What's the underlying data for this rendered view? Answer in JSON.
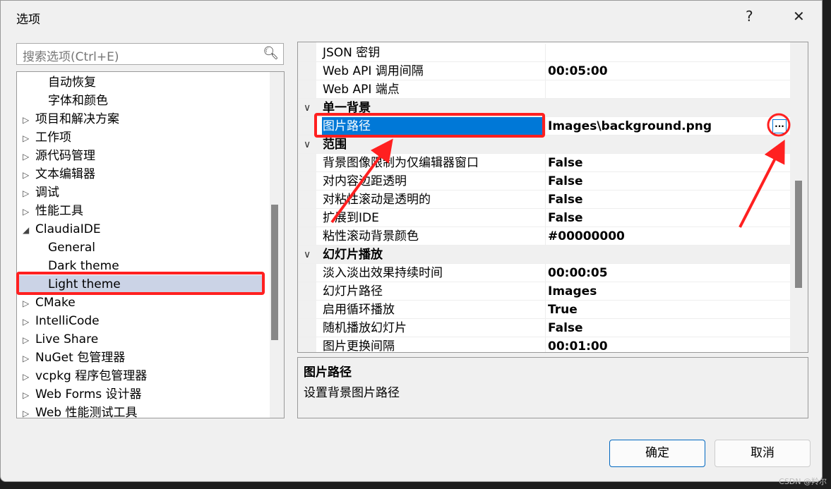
{
  "dialog": {
    "title": "选项",
    "help": "?",
    "close": "✕"
  },
  "search": {
    "placeholder": "搜索选项(Ctrl+E)"
  },
  "tree": [
    {
      "label": "自动恢复",
      "indent": 1,
      "arrow": ""
    },
    {
      "label": "字体和颜色",
      "indent": 1,
      "arrow": ""
    },
    {
      "label": "项目和解决方案",
      "indent": 0,
      "arrow": "▷"
    },
    {
      "label": "工作项",
      "indent": 0,
      "arrow": "▷"
    },
    {
      "label": "源代码管理",
      "indent": 0,
      "arrow": "▷"
    },
    {
      "label": "文本编辑器",
      "indent": 0,
      "arrow": "▷"
    },
    {
      "label": "调试",
      "indent": 0,
      "arrow": "▷"
    },
    {
      "label": "性能工具",
      "indent": 0,
      "arrow": "▷"
    },
    {
      "label": "ClaudiaIDE",
      "indent": 0,
      "arrow": "◢"
    },
    {
      "label": "General",
      "indent": 1,
      "arrow": ""
    },
    {
      "label": "Dark theme",
      "indent": 1,
      "arrow": ""
    },
    {
      "label": "Light theme",
      "indent": 1,
      "arrow": "",
      "selected": true
    },
    {
      "label": "CMake",
      "indent": 0,
      "arrow": "▷"
    },
    {
      "label": "IntelliCode",
      "indent": 0,
      "arrow": "▷"
    },
    {
      "label": "Live Share",
      "indent": 0,
      "arrow": "▷"
    },
    {
      "label": "NuGet 包管理器",
      "indent": 0,
      "arrow": "▷"
    },
    {
      "label": "vcpkg 程序包管理器",
      "indent": 0,
      "arrow": "▷"
    },
    {
      "label": "Web Forms 设计器",
      "indent": 0,
      "arrow": "▷"
    },
    {
      "label": "Web 性能测试工具",
      "indent": 0,
      "arrow": "▷"
    }
  ],
  "grid": [
    {
      "name": "JSON 密钥",
      "value": ""
    },
    {
      "name": "Web API 调用间隔",
      "value": "00:05:00"
    },
    {
      "name": "Web API 端点",
      "value": ""
    },
    {
      "name": "单一背景",
      "category": true
    },
    {
      "name": "图片路径",
      "value": "Images\\background.png",
      "selected": true,
      "button": "..."
    },
    {
      "name": "范围",
      "category": true
    },
    {
      "name": "背景图像限制为仅编辑器窗口",
      "value": "False"
    },
    {
      "name": "对内容边距透明",
      "value": "False"
    },
    {
      "name": "对粘性滚动是透明的",
      "value": "False"
    },
    {
      "name": "扩展到IDE",
      "value": "False"
    },
    {
      "name": "粘性滚动背景颜色",
      "value": "#00000000"
    },
    {
      "name": "幻灯片播放",
      "category": true
    },
    {
      "name": "淡入淡出效果持续时间",
      "value": "00:00:05"
    },
    {
      "name": "幻灯片路径",
      "value": "Images"
    },
    {
      "name": "启用循环播放",
      "value": "True"
    },
    {
      "name": "随机播放幻灯片",
      "value": "False"
    },
    {
      "name": "图片更换间隔",
      "value": "00:01:00"
    }
  ],
  "description": {
    "title": "图片路径",
    "text": "设置背景图片路径"
  },
  "buttons": {
    "ok": "确定",
    "cancel": "取消"
  },
  "watermark": "CSDN @羚尔",
  "colors": {
    "selection": "#0078d7",
    "annotation": "#ff2020"
  }
}
